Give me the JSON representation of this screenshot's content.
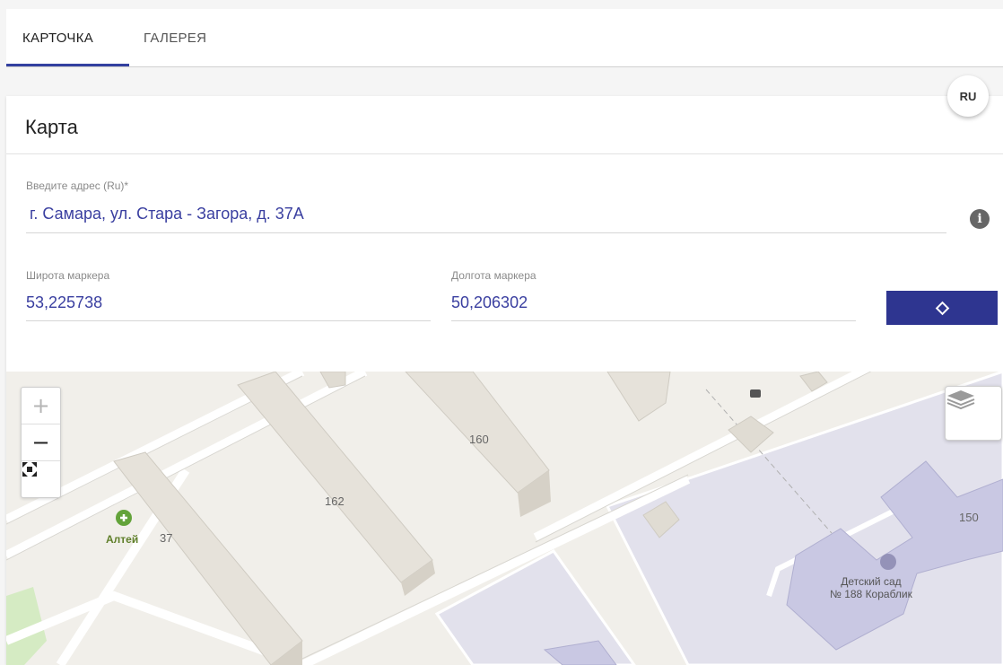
{
  "tabs": [
    {
      "label": "КАРТОЧКА",
      "active": true
    },
    {
      "label": "ГАЛЕРЕЯ",
      "active": false
    }
  ],
  "card": {
    "title": "Карта",
    "lang_button": "RU"
  },
  "form": {
    "address": {
      "label": "Введите адрес (Ru)*",
      "value": "г. Самара, ул. Стара - Загора, д. 37А"
    },
    "latitude": {
      "label": "Широта маркера",
      "value": "53,225738"
    },
    "longitude": {
      "label": "Долгота маркера",
      "value": "50,206302"
    },
    "info_icon": "info-icon",
    "locate_icon": "locate-icon"
  },
  "map": {
    "zoom_in": "+",
    "zoom_out": "−",
    "labels": {
      "house_160": "160",
      "house_162": "162",
      "house_37": "37",
      "house_150": "150",
      "poi_altei": "Алтей",
      "kindergarten_line1": "Детский сад",
      "kindergarten_line2": "№ 188 Кораблик"
    },
    "colors": {
      "accent": "#2e3590",
      "building": "#e3dfd6",
      "kindergarten": "#c9c8e3",
      "park": "#d5ebc3",
      "road": "#ffffff"
    }
  }
}
